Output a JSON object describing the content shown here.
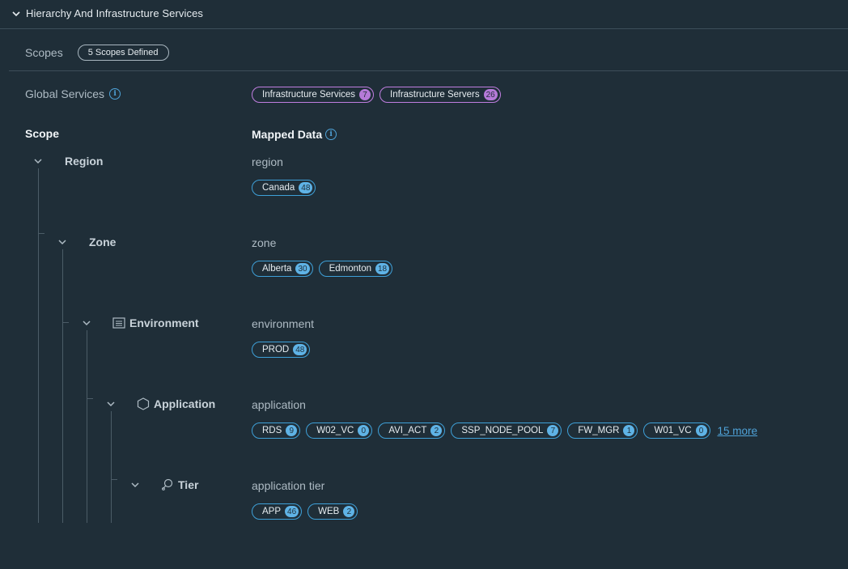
{
  "header": {
    "title": "Hierarchy And Infrastructure Services"
  },
  "scopes": {
    "label": "Scopes",
    "badge": "5 Scopes Defined"
  },
  "global_services": {
    "label": "Global Services",
    "pills": [
      {
        "label": "Infrastructure Services",
        "count": "7"
      },
      {
        "label": "Infrastructure Servers",
        "count": "26"
      }
    ]
  },
  "columns": {
    "scope": "Scope",
    "mapped": "Mapped Data"
  },
  "hierarchy": [
    {
      "name": "Region",
      "mapped_label": "region",
      "pills": [
        {
          "label": "Canada",
          "count": "48"
        }
      ]
    },
    {
      "name": "Zone",
      "mapped_label": "zone",
      "pills": [
        {
          "label": "Alberta",
          "count": "30"
        },
        {
          "label": "Edmonton",
          "count": "18"
        }
      ]
    },
    {
      "name": "Environment",
      "mapped_label": "environment",
      "pills": [
        {
          "label": "PROD",
          "count": "48"
        }
      ]
    },
    {
      "name": "Application",
      "mapped_label": "application",
      "pills": [
        {
          "label": "RDS",
          "count": "9"
        },
        {
          "label": "W02_VC",
          "count": "0"
        },
        {
          "label": "AVI_ACT",
          "count": "2"
        },
        {
          "label": "SSP_NODE_POOL",
          "count": "7"
        },
        {
          "label": "FW_MGR",
          "count": "1"
        },
        {
          "label": "W01_VC",
          "count": "0"
        }
      ],
      "more": "15 more"
    },
    {
      "name": "Tier",
      "mapped_label": "application tier",
      "pills": [
        {
          "label": "APP",
          "count": "46"
        },
        {
          "label": "WEB",
          "count": "2"
        }
      ]
    }
  ]
}
